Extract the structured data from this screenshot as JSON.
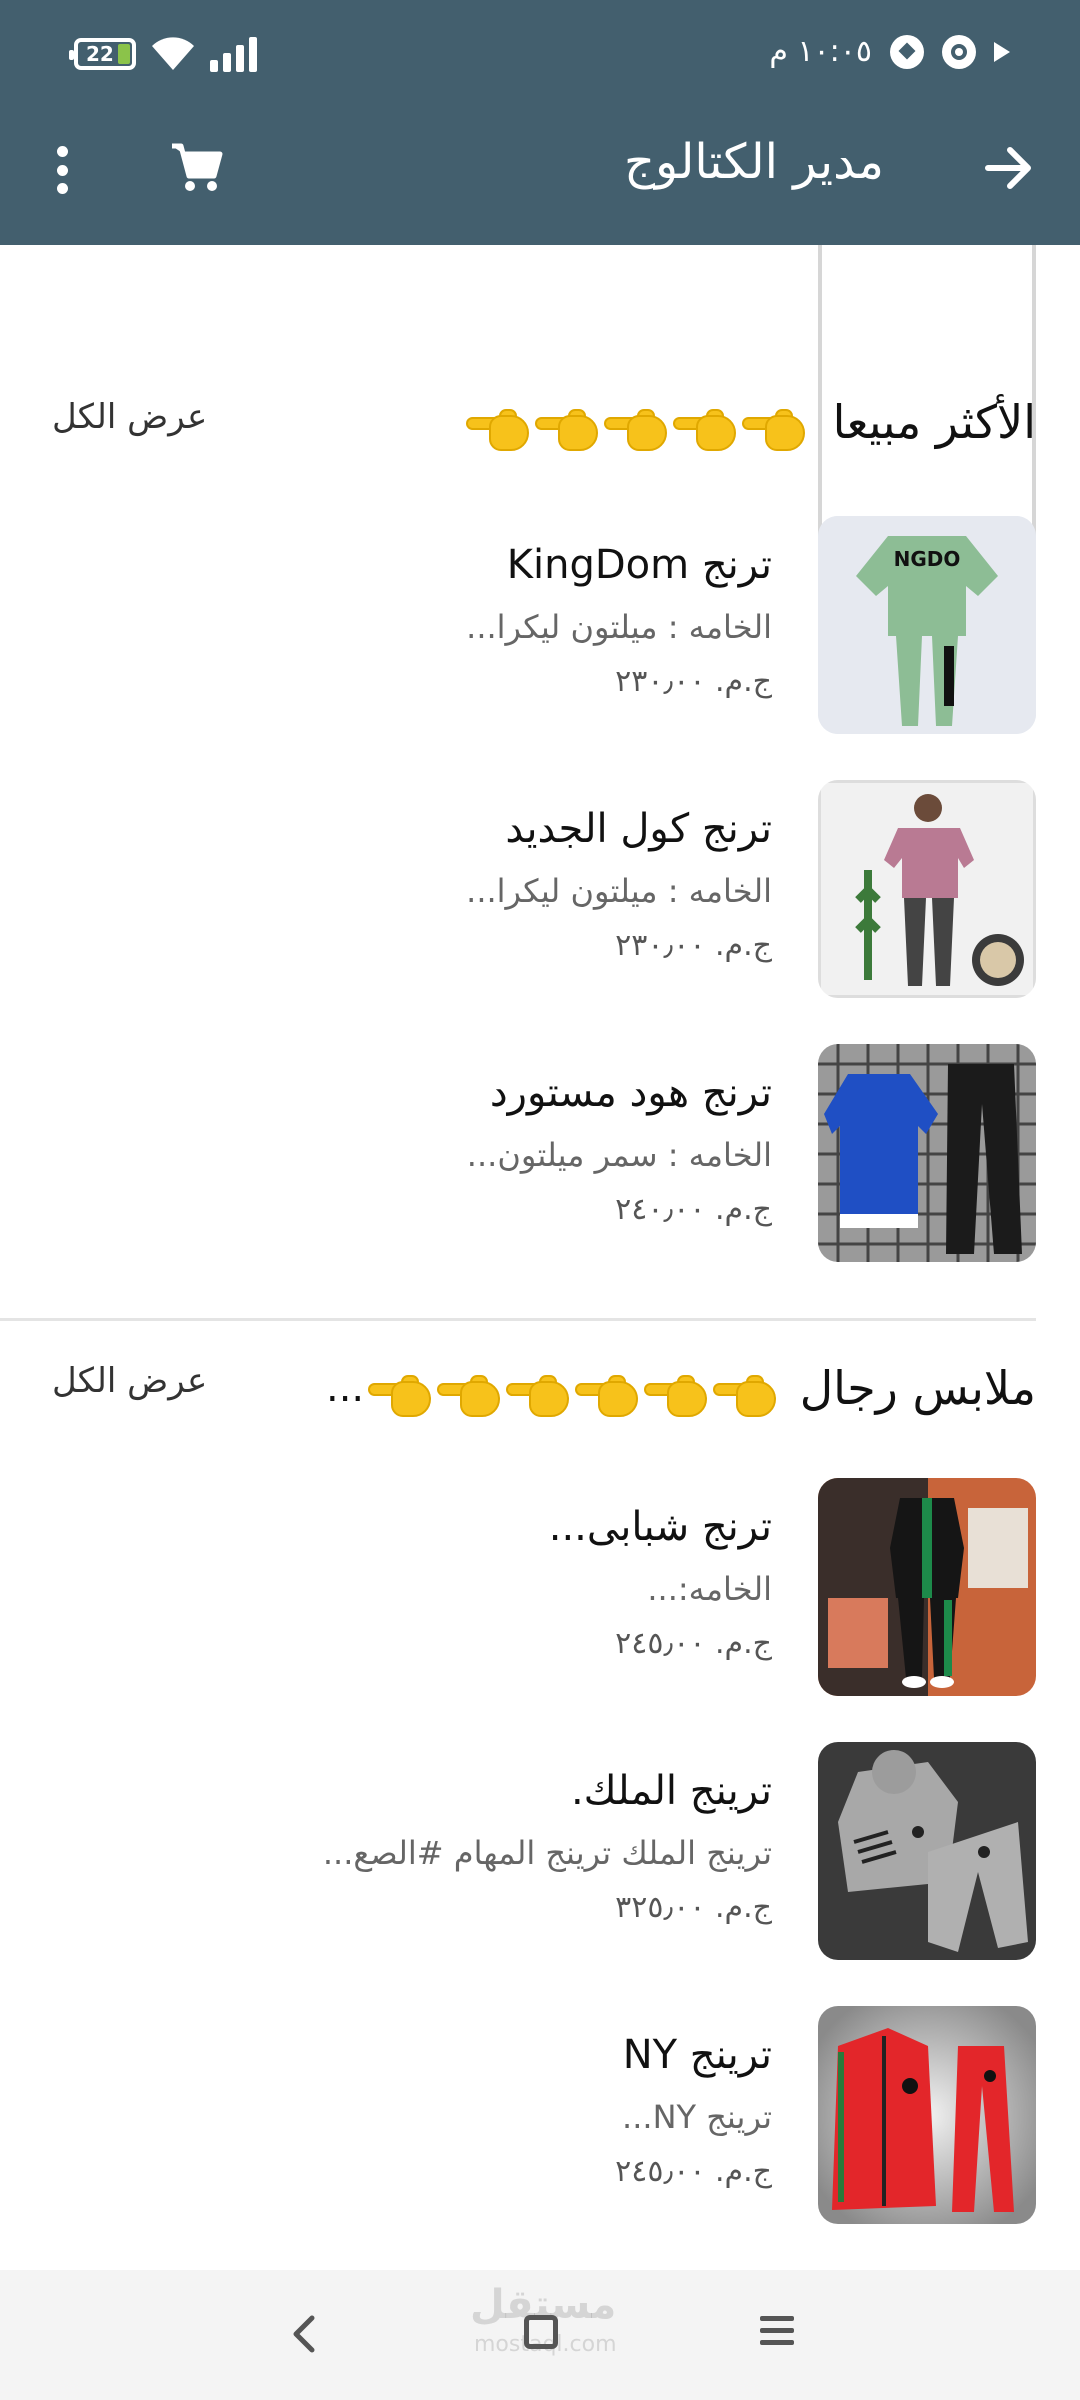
{
  "status_bar": {
    "time": "١٠:٠٥ م",
    "battery_level": "22"
  },
  "toolbar": {
    "title": "مدير الكتالوج",
    "icons": [
      "back-arrow-icon",
      "cart-icon",
      "more-vert-icon"
    ]
  },
  "sections": [
    {
      "title": "الأكثر مبيعا",
      "view_all": "عرض الكل",
      "emoji_count": 5,
      "truncated": false,
      "products": [
        {
          "name": "ترنج KingDom",
          "desc": "الخامه : ميلتون ليكرا...",
          "price": "ج.م. ٢٣٠٫٠٠"
        },
        {
          "name": "ترنج كول الجديد",
          "desc": "الخامه : ميلتون ليكرا...",
          "price": "ج.م. ٢٣٠٫٠٠"
        },
        {
          "name": "ترنج هود مستورد",
          "desc": "الخامه : سمر ميلتون...",
          "price": "ج.م. ٢٤٠٫٠٠"
        }
      ]
    },
    {
      "title": "ملابس رجال",
      "view_all": "عرض الكل",
      "emoji_count": 6,
      "truncated": true,
      "ellipsis": "...",
      "products": [
        {
          "name": "ترنج شبابى...",
          "desc": "الخامه:...",
          "price": "ج.م. ٢٤٥٫٠٠"
        },
        {
          "name": "ترينج الملك.",
          "desc": "ترينج الملك ترينج المهام #الصع...",
          "price": "ج.م. ٣٢٥٫٠٠"
        },
        {
          "name": "ترينج NY",
          "desc": "ترينج NY...",
          "price": "ج.م. ٢٤٥٫٠٠"
        }
      ]
    }
  ],
  "nav_bar": {
    "watermark": "مستقل",
    "watermark_sub": "mostaql.com"
  },
  "colors": {
    "appbar": "#435f6e",
    "thumb_green": "#8dbd95",
    "thumb_pink": "#b97a93",
    "thumb_blue": "#1f4fc4",
    "thumb_dark": "#2a2a2a",
    "thumb_grey": "#a8a8a8",
    "thumb_red": "#e3262a"
  }
}
